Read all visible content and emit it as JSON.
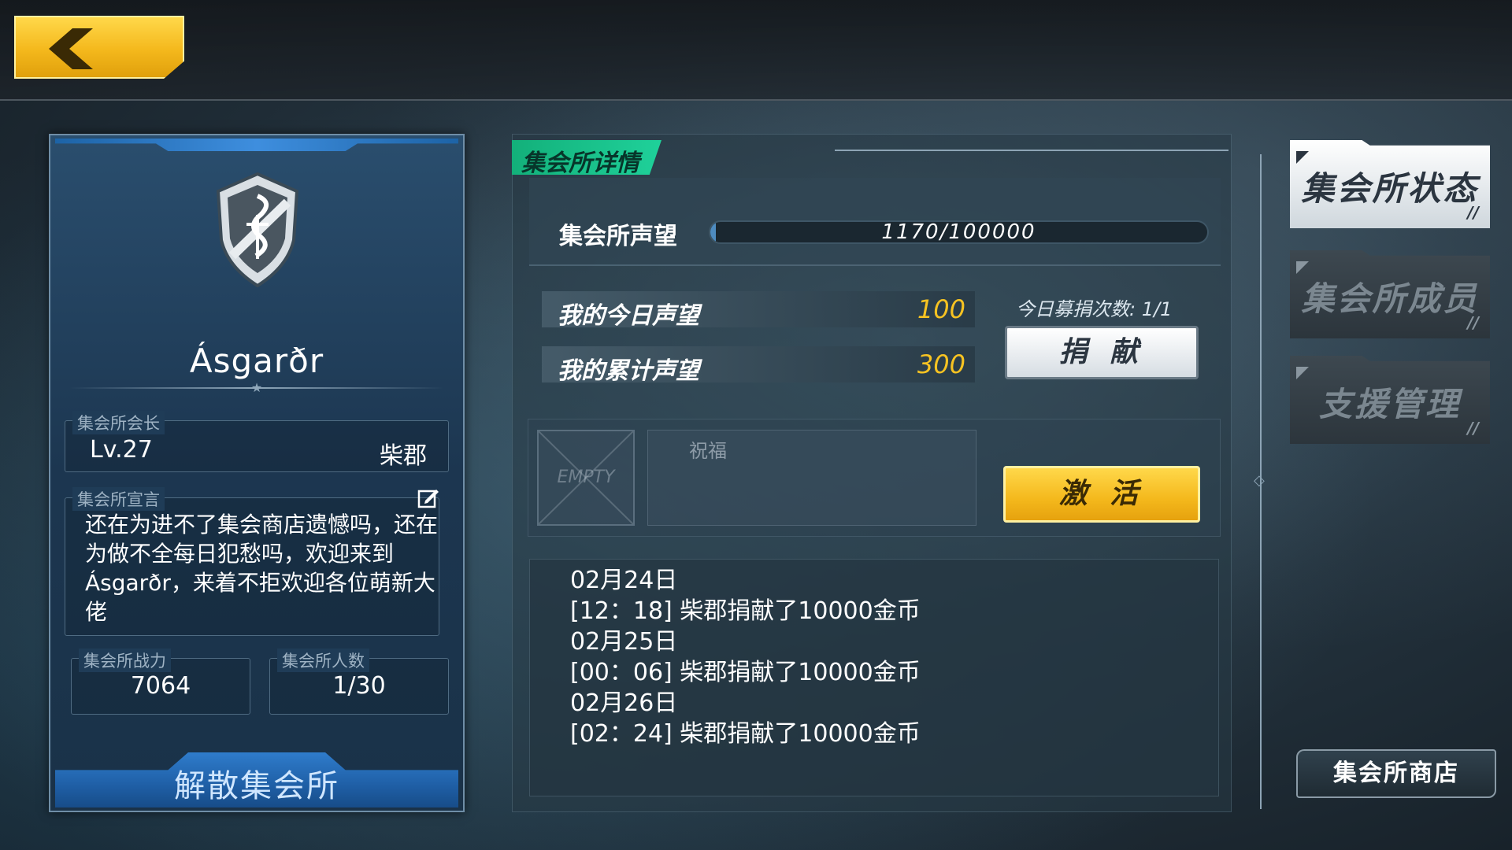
{
  "colors": {
    "accent_yellow": "#f4b81c",
    "accent_green": "#1fd19a",
    "accent_blue": "#1f5fa6",
    "value_gold": "#f7c322"
  },
  "nav": {
    "back_icon": "chevron-left-icon"
  },
  "guild": {
    "emblem_icon": "serpent-shield-icon",
    "name": "Ásgarðr",
    "leader_label": "集会所会长",
    "leader_level": "Lv.27",
    "leader_name": "柴郡",
    "declaration_label": "集会所宣言",
    "declaration_text": "还在为进不了集会商店遗憾吗，还在为做不全每日犯愁吗，欢迎来到Ásgarðr，来着不拒欢迎各位萌新大佬",
    "power_label": "集会所战力",
    "power_value": "7064",
    "members_label": "集会所人数",
    "members_value": "1/30",
    "disband_label": "解散集会所"
  },
  "details": {
    "tab_label": "集会所详情",
    "reputation_label": "集会所声望",
    "reputation_text": "1170/100000",
    "reputation_current": 1170,
    "reputation_max": 100000,
    "today_label": "我的今日声望",
    "today_value": "100",
    "total_label": "我的累计声望",
    "total_value": "300",
    "donate_count": "今日募捐次数: 1/1",
    "donate_button": "捐 献",
    "empty_slot": "EMPTY",
    "bless_label": "祝福",
    "activate_button": "激 活",
    "log": [
      "02月24日",
      "[12：18] 柴郡捐献了10000金币",
      "02月25日",
      "[00：06] 柴郡捐献了10000金币",
      "02月26日",
      "[02：24] 柴郡捐献了10000金币"
    ]
  },
  "side_tabs": [
    {
      "label": "集会所状态",
      "active": true
    },
    {
      "label": "集会所成员",
      "active": false
    },
    {
      "label": "支援管理",
      "active": false
    }
  ],
  "shop_button": "集会所商店"
}
